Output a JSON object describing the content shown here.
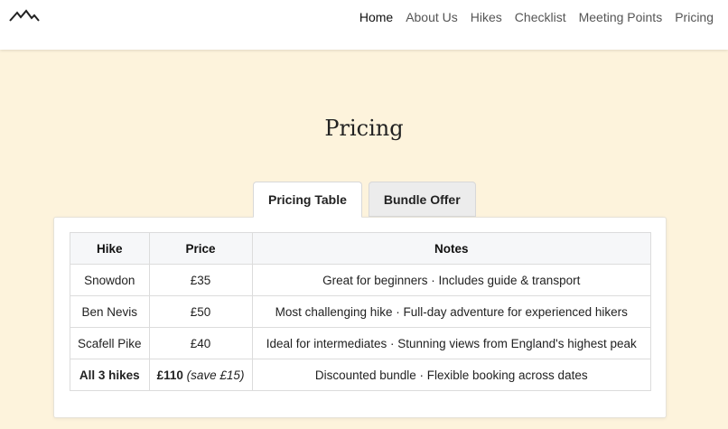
{
  "nav": {
    "logo_icon": "mountain-icon",
    "links": [
      {
        "label": "Home",
        "active": true
      },
      {
        "label": "About Us",
        "active": false
      },
      {
        "label": "Hikes",
        "active": false
      },
      {
        "label": "Checklist",
        "active": false
      },
      {
        "label": "Meeting Points",
        "active": false
      },
      {
        "label": "Pricing",
        "active": false
      }
    ]
  },
  "page": {
    "title": "Pricing"
  },
  "tabs": [
    {
      "label": "Pricing Table",
      "active": true
    },
    {
      "label": "Bundle Offer",
      "active": false
    }
  ],
  "table": {
    "headers": [
      "Hike",
      "Price",
      "Notes"
    ],
    "rows": [
      {
        "hike": "Snowdon",
        "price": "£35",
        "notes": "Great for beginners · Includes guide & transport"
      },
      {
        "hike": "Ben Nevis",
        "price": "£50",
        "notes": "Most challenging hike · Full-day adventure for experienced hikers"
      },
      {
        "hike": "Scafell Pike",
        "price": "£40",
        "notes": "Ideal for intermediates · Stunning views from England's highest peak"
      }
    ],
    "total": {
      "hike": "All 3 hikes",
      "price": "£110",
      "save": "(save £15)",
      "notes": "Discounted bundle · Flexible booking across dates"
    }
  },
  "colors": {
    "background": "#fdf3dc",
    "navbar": "#ffffff",
    "card": "#ffffff",
    "header_cell": "#f6f7f9",
    "inactive_tab": "#ececec"
  }
}
